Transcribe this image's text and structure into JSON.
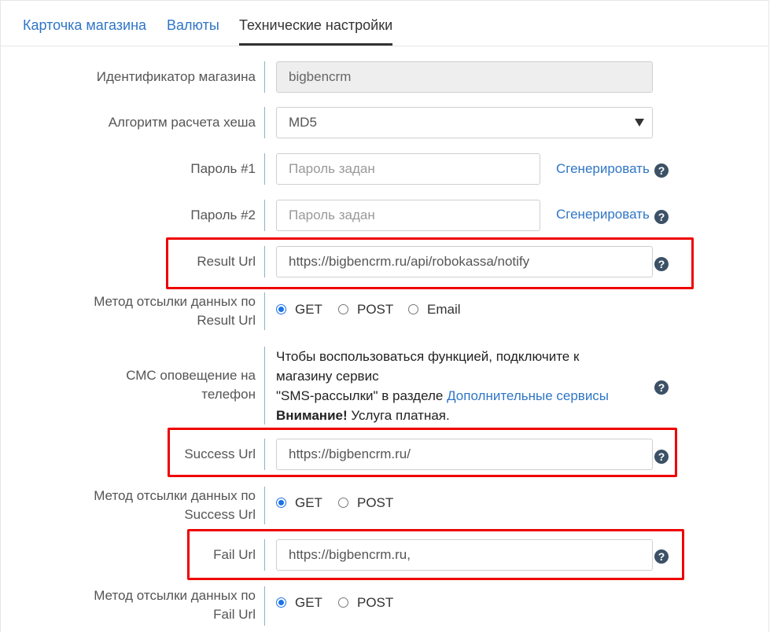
{
  "tabs": [
    {
      "label": "Карточка магазина",
      "active": false
    },
    {
      "label": "Валюты",
      "active": false
    },
    {
      "label": "Технические настройки",
      "active": true
    }
  ],
  "form": {
    "shop_id": {
      "label": "Идентификатор магазина",
      "value": "bigbencrm"
    },
    "hash_algo": {
      "label": "Алгоритм расчета хеша",
      "value": "MD5"
    },
    "password1": {
      "label": "Пароль #1",
      "placeholder": "Пароль задан",
      "generate": "Сгенерировать"
    },
    "password2": {
      "label": "Пароль #2",
      "placeholder": "Пароль задан",
      "generate": "Сгенерировать"
    },
    "result_url": {
      "label": "Result Url",
      "value": "https://bigbencrm.ru/api/robokassa/notify"
    },
    "result_method": {
      "label_line1": "Метод отсылки данных по",
      "label_line2": "Result Url",
      "options": [
        "GET",
        "POST",
        "Email"
      ],
      "selected": "GET"
    },
    "sms": {
      "label_line1": "СМС оповещение на",
      "label_line2": "телефон",
      "text_line1": "Чтобы воспользоваться функцией, подключите к",
      "text_line2": "магазину сервис",
      "text_line3_prefix": "\"SMS-рассылки\" в разделе ",
      "text_link": "Дополнительные сервисы",
      "warning_bold": "Внимание!",
      "warning_rest": " Услуга платная."
    },
    "success_url": {
      "label": "Success Url",
      "value": "https://bigbencrm.ru/"
    },
    "success_method": {
      "label_line1": "Метод отсылки данных по",
      "label_line2": "Success Url",
      "options": [
        "GET",
        "POST"
      ],
      "selected": "GET"
    },
    "fail_url": {
      "label": "Fail Url",
      "value": "https://bigbencrm.ru,"
    },
    "fail_method": {
      "label_line1": "Метод отсылки данных по",
      "label_line2": "Fail Url",
      "options": [
        "GET",
        "POST"
      ],
      "selected": "GET"
    }
  },
  "help_glyph": "?",
  "colors": {
    "link": "#2f76c6",
    "highlight": "#ef0000",
    "radio": "#1a73e8",
    "help": "#3c5166"
  }
}
